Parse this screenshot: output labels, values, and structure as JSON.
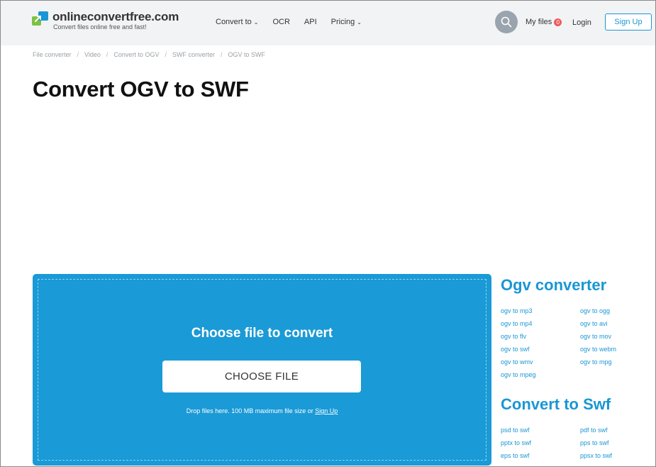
{
  "header": {
    "logo_name": "onlineconvertfree.com",
    "logo_tagline": "Convert files online free and fast!",
    "nav": [
      {
        "label": "Convert to",
        "dropdown": true
      },
      {
        "label": "OCR",
        "dropdown": false
      },
      {
        "label": "API",
        "dropdown": false
      },
      {
        "label": "Pricing",
        "dropdown": true
      }
    ],
    "my_files_label": "My files",
    "my_files_count": "0",
    "login_label": "Login",
    "signup_label": "Sign Up"
  },
  "breadcrumb": [
    "File converter",
    "Video",
    "Convert to OGV",
    "SWF converter",
    "OGV to SWF"
  ],
  "page_title": "Convert OGV to SWF",
  "upload": {
    "heading": "Choose file to convert",
    "button_label": "CHOOSE FILE",
    "note_prefix": "Drop files here. 100 MB maximum file size or ",
    "note_link": "Sign Up"
  },
  "ogv_converter": {
    "title": "Ogv converter",
    "links": [
      "ogv to mp3",
      "ogv to ogg",
      "ogv to mp4",
      "ogv to avi",
      "ogv to flv",
      "ogv to mov",
      "ogv to swf",
      "ogv to webm",
      "ogv to wmv",
      "ogv to mpg",
      "ogv to mpeg"
    ]
  },
  "convert_to_swf": {
    "title": "Convert to Swf",
    "links": [
      "psd to swf",
      "pdf to swf",
      "pptx to swf",
      "pps to swf",
      "eps to swf",
      "ppsx to swf"
    ]
  },
  "colors": {
    "accent": "#1a96d4",
    "upload_bg": "#1a9ad6",
    "header_bg": "#f2f3f5",
    "badge": "#f05a5a"
  },
  "icons": {
    "logo": "logo-arrow-icon",
    "search": "search-icon",
    "dropdown": "chevron-down-icon"
  }
}
